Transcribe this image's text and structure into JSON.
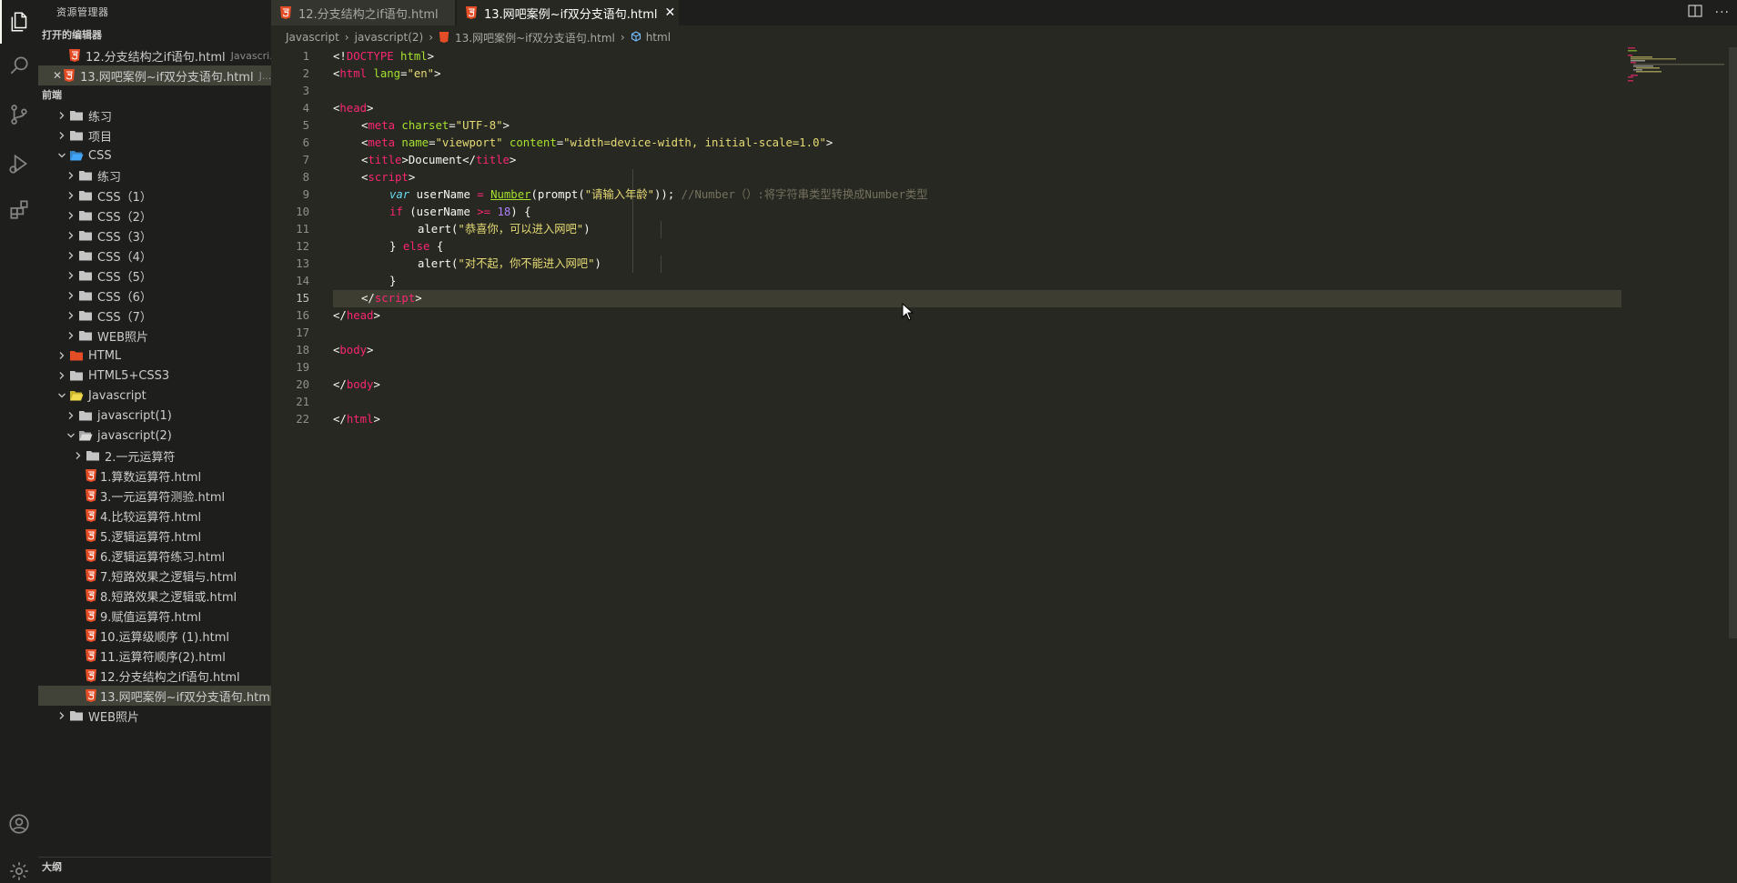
{
  "sidebar": {
    "title": "资源管理器",
    "open_editors_label": "打开的编辑器",
    "open_editors": [
      {
        "name": "12.分支结构之if语句.html",
        "desc": "Javascri..."
      },
      {
        "name": "13.网吧案例~if双分支语句.html",
        "desc": "J..."
      }
    ],
    "workspace_label": "前端",
    "tree": [
      {
        "label": "练习"
      },
      {
        "label": "项目"
      },
      {
        "label": "CSS"
      },
      {
        "label": "练习"
      },
      {
        "label": "CSS（1）"
      },
      {
        "label": "CSS（2）"
      },
      {
        "label": "CSS（3）"
      },
      {
        "label": "CSS（4）"
      },
      {
        "label": "CSS（5）"
      },
      {
        "label": "CSS（6）"
      },
      {
        "label": "CSS（7）"
      },
      {
        "label": "WEB照片"
      },
      {
        "label": "HTML"
      },
      {
        "label": "HTML5+CSS3"
      },
      {
        "label": "Javascript"
      },
      {
        "label": "javascript(1)"
      },
      {
        "label": "javascript(2)"
      },
      {
        "label": "2.一元运算符"
      },
      {
        "label": "1.算数运算符.html"
      },
      {
        "label": "3.一元运算符测验.html"
      },
      {
        "label": "4.比较运算符.html"
      },
      {
        "label": "5.逻辑运算符.html"
      },
      {
        "label": "6.逻辑运算符练习.html"
      },
      {
        "label": "7.短路效果之逻辑与.html"
      },
      {
        "label": "8.短路效果之逻辑或.html"
      },
      {
        "label": "9.赋值运算符.html"
      },
      {
        "label": "10.运算级顺序 (1).html"
      },
      {
        "label": "11.运算符顺序(2).html"
      },
      {
        "label": "12.分支结构之if语句.html"
      },
      {
        "label": "13.网吧案例~if双分支语句.html"
      },
      {
        "label": "WEB照片"
      }
    ],
    "outline_label": "大纲"
  },
  "tabs": [
    {
      "label": "12.分支结构之if语句.html"
    },
    {
      "label": "13.网吧案例~if双分支语句.html"
    }
  ],
  "breadcrumb": {
    "folder1": "Javascript",
    "folder2": "javascript(2)",
    "file": "13.网吧案例~if双分支语句.html",
    "symbol": "html"
  },
  "editor": {
    "line_numbers": [
      "1",
      "2",
      "3",
      "4",
      "5",
      "6",
      "7",
      "8",
      "9",
      "10",
      "11",
      "12",
      "13",
      "14",
      "15",
      "16",
      "17",
      "18",
      "19",
      "20",
      "21",
      "22"
    ],
    "l1": {
      "a": "<!",
      "b": "DOCTYPE",
      "c": " html",
      "d": ">"
    },
    "l2": {
      "a": "<",
      "b": "html",
      "c": " lang",
      "d": "=",
      "e": "\"en\"",
      "f": ">"
    },
    "l4": {
      "a": "<",
      "b": "head",
      "c": ">"
    },
    "l5": {
      "a": "<",
      "b": "meta",
      "c": " charset",
      "d": "=",
      "e": "\"UTF-8\"",
      "f": ">"
    },
    "l6": {
      "a": "<",
      "b": "meta",
      "c": " name",
      "d": "=",
      "e": "\"viewport\"",
      "f": " content",
      "g": "=",
      "h": "\"width=device-width, initial-scale=1.0\"",
      "i": ">"
    },
    "l7": {
      "a": "<",
      "b": "title",
      "c": ">",
      "d": "Document",
      "e": "</",
      "f": "title",
      "g": ">"
    },
    "l8": {
      "a": "<",
      "b": "script",
      "c": ">"
    },
    "l9": {
      "a": "var",
      "b": " userName ",
      "c": "=",
      "d": " ",
      "e": "Number",
      "f": "(prompt(",
      "g": "\"请输入年龄\"",
      "h": ")); ",
      "i": "//Number（）:将字符串类型转换成Number类型"
    },
    "l10": {
      "a": "if",
      "b": " (userName ",
      "c": ">=",
      "d": " ",
      "e": "18",
      "f": ") {"
    },
    "l11": {
      "a": "alert(",
      "b": "\"恭喜你，可以进入网吧\"",
      "c": ")"
    },
    "l12": {
      "a": "} ",
      "b": "else",
      "c": " {"
    },
    "l13": {
      "a": "alert(",
      "b": "\"对不起，你不能进入网吧\"",
      "c": ")"
    },
    "l14": {
      "a": "}"
    },
    "l15": {
      "a": "</",
      "b": "script",
      "c": ">"
    },
    "l16": {
      "a": "</",
      "b": "head",
      "c": ">"
    },
    "l18": {
      "a": "<",
      "b": "body",
      "c": ">"
    },
    "l20": {
      "a": "</",
      "b": "body",
      "c": ">"
    },
    "l22": {
      "a": "</",
      "b": "html",
      "c": ">"
    }
  },
  "colors": {
    "editor_bg": "#272822",
    "sidebar_bg": "#1e1f1c",
    "tag": "#f92672",
    "attr": "#a6e22e",
    "string": "#e6db74",
    "keyword": "#66d9ef",
    "number": "#ae81ff",
    "comment": "#75715e",
    "html5_icon": "#e44d26"
  }
}
